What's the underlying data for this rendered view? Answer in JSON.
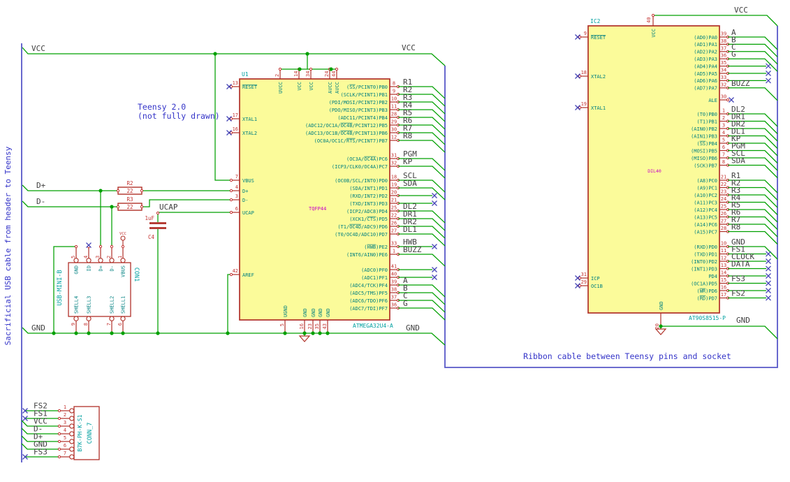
{
  "colors": {
    "wire": "#00A000",
    "bus": "#5858C8",
    "component_outline": "#B03028",
    "ic_fill": "#FBFB9A",
    "pin_number": "#C33432",
    "pin_name": "#008080",
    "ref_value": "#00A0A0",
    "footprint": "#C800C8",
    "net_label": "#3F3F3F",
    "note": "#3434C8",
    "no_connect": "#4848B8",
    "junction": "#00A000"
  },
  "notes": {
    "left_cable": "Sacrificial USB cable from header to Teensy",
    "teensy_1": "Teensy 2.0",
    "teensy_2": "(not fully drawn)",
    "ribbon": "Ribbon cable between Teensy pins and socket"
  },
  "power": {
    "vcc": "VCC",
    "gnd": "GND",
    "dplus": "D+",
    "dminus": "D-",
    "ucap": "UCAP"
  },
  "r2": {
    "ref": "R2",
    "value": "22"
  },
  "r3": {
    "ref": "R3",
    "value": "22"
  },
  "c4": {
    "ref": "C4",
    "value": "1uF"
  },
  "u1": {
    "ref": "U1",
    "value": "ATMEGA32U4-A",
    "footprint": "TQFP44",
    "left_pins": [
      {
        "num": "13",
        "name": "~RESET~",
        "nc": true
      },
      {
        "num": "17",
        "name": "XTAL1",
        "nc": true
      },
      {
        "num": "16",
        "name": "XTAL2",
        "nc": true
      },
      {
        "num": "7",
        "name": "VBUS"
      },
      {
        "num": "4",
        "name": "D+"
      },
      {
        "num": "3",
        "name": "D-"
      },
      {
        "num": "6",
        "name": "UCAP"
      },
      {
        "num": "42",
        "name": "AREF"
      }
    ],
    "top_pins": [
      {
        "num": "2",
        "name": "UVCC"
      },
      {
        "num": "14",
        "name": "VCC"
      },
      {
        "num": "34",
        "name": "VCC"
      },
      {
        "num": "24",
        "name": "AVCC"
      },
      {
        "num": "44",
        "name": "AVCC"
      }
    ],
    "bottom_pins": [
      {
        "num": "5",
        "name": "UGND"
      },
      {
        "num": "16",
        "name": "GND"
      },
      {
        "num": "23",
        "name": "GND"
      },
      {
        "num": "35",
        "name": "GND"
      },
      {
        "num": "43",
        "name": "GND"
      }
    ],
    "right_groups": [
      {
        "pins": [
          {
            "num": "8",
            "name": "(~SS~/PCINT0)PB0",
            "net": "R1"
          },
          {
            "num": "9",
            "name": "(SCLK/PCINT1)PB1",
            "net": "R2"
          },
          {
            "num": "10",
            "name": "(PDI/MOSI/PCINT2)PB2",
            "net": "R3"
          },
          {
            "num": "11",
            "name": "(PDO/MISO/PCINT3)PB3",
            "net": "R4"
          },
          {
            "num": "28",
            "name": "(ADC11/PCINT4)PB4",
            "net": "R5"
          },
          {
            "num": "29",
            "name": "(ADC12/OC1A/~OC4B~/PCINT12)PB5",
            "net": "R6"
          },
          {
            "num": "30",
            "name": "(ADC13/OC1B/~OC4B~/PCINT13)PB6",
            "net": "R7"
          },
          {
            "num": "12",
            "name": "(OC0A/OC1C/~RTS~/PCINT7)PB7",
            "net": "R8"
          }
        ]
      },
      {
        "pins": [
          {
            "num": "31",
            "name": "(OC3A/~OC4A~)PC6",
            "net": "PGM"
          },
          {
            "num": "32",
            "name": "(ICP3/CLK0/OC4A)PC7",
            "net": "KP"
          }
        ]
      },
      {
        "pins": [
          {
            "num": "18",
            "name": "(OC0B/SCL/INT0)PD0",
            "net": "SCL"
          },
          {
            "num": "19",
            "name": "(SDA/INT1)PD1",
            "net": "SDA"
          },
          {
            "num": "20",
            "name": "(RXD/INT2)PD2",
            "nc": true
          },
          {
            "num": "21",
            "name": "(TXD/INT3)PD3",
            "nc": true
          },
          {
            "num": "25",
            "name": "(ICP2/ADC8)PD4",
            "net": "DL2"
          },
          {
            "num": "22",
            "name": "(XCK1/~CTS~)PD5",
            "net": "DR1"
          },
          {
            "num": "26",
            "name": "(T1/~OC4D~/ADC9)PD6",
            "net": "DR2"
          },
          {
            "num": "27",
            "name": "(T0/OC4D/ADC10)PD7",
            "net": "DL1"
          }
        ]
      },
      {
        "pins": [
          {
            "num": "33",
            "name": "(~HWB~)PE2",
            "net": "HWB",
            "nc": true
          },
          {
            "num": "1",
            "name": "(INT6/AIN0)PE6",
            "net": "BUZZ"
          }
        ]
      },
      {
        "pins": [
          {
            "num": "41",
            "name": "(ADC0)PF0",
            "nc": true
          },
          {
            "num": "40",
            "name": "(ADC1)PF1",
            "nc": true
          },
          {
            "num": "39",
            "name": "(ADC4/TCK)PF4",
            "net": "A"
          },
          {
            "num": "38",
            "name": "(ADC5/TMS)PF5",
            "net": "B"
          },
          {
            "num": "37",
            "name": "(ADC6/TDO)PF6",
            "net": "C"
          },
          {
            "num": "36",
            "name": "(ADC7/TDI)PF7",
            "net": "G"
          }
        ]
      }
    ]
  },
  "ic2": {
    "ref": "IC2",
    "value": "AT90S8515-P",
    "footprint": "DIL40",
    "left_pins": [
      {
        "num": "9",
        "name": "~RESET~",
        "nc": true
      },
      {
        "num": "18",
        "name": "XTAL2",
        "nc": true
      },
      {
        "num": "19",
        "name": "XTAL1",
        "nc": true
      },
      {
        "num": "31",
        "name": "ICP",
        "nc": true
      },
      {
        "num": "29",
        "name": "OC1B",
        "nc": true
      }
    ],
    "top_pins": [
      {
        "num": "40",
        "name": "VCC"
      }
    ],
    "bottom_pins": [
      {
        "num": "20",
        "name": "GND"
      }
    ],
    "right_groups": [
      {
        "pins": [
          {
            "num": "39",
            "name": "(AD0)PA0",
            "net": "A"
          },
          {
            "num": "38",
            "name": "(AD1)PA1",
            "net": "B"
          },
          {
            "num": "37",
            "name": "(AD2)PA2",
            "net": "C"
          },
          {
            "num": "36",
            "name": "(AD3)PA3",
            "net": "G"
          },
          {
            "num": "35",
            "name": "(AD4)PA4",
            "nc": true
          },
          {
            "num": "34",
            "name": "(AD5)PA5",
            "nc": true
          },
          {
            "num": "33",
            "name": "(AD6)PA6",
            "nc": true
          },
          {
            "num": "32",
            "name": "(AD7)PA7",
            "net": "BUZZ"
          }
        ]
      },
      {
        "pins": [
          {
            "num": "30",
            "name": "ALE",
            "nc": true,
            "short": true
          }
        ]
      },
      {
        "pins": [
          {
            "num": "1",
            "name": "(T0)PB0",
            "net": "DL2"
          },
          {
            "num": "2",
            "name": "(T1)PB1",
            "net": "DR1"
          },
          {
            "num": "3",
            "name": "(AIN0)PB2",
            "net": "DR2"
          },
          {
            "num": "4",
            "name": "(AIN1)PB3",
            "net": "DL1"
          },
          {
            "num": "5",
            "name": "(~SS~)PB4",
            "net": "KP"
          },
          {
            "num": "6",
            "name": "(MOSI)PB5",
            "net": "PGM"
          },
          {
            "num": "7",
            "name": "(MISO)PB6",
            "net": "SCL"
          },
          {
            "num": "8",
            "name": "(SCK)PB7",
            "net": "SDA"
          }
        ]
      },
      {
        "pins": [
          {
            "num": "21",
            "name": "(A8)PC0",
            "net": "R1"
          },
          {
            "num": "22",
            "name": "(A9)PC1",
            "net": "R2"
          },
          {
            "num": "23",
            "name": "(A10)PC2",
            "net": "R3"
          },
          {
            "num": "24",
            "name": "(A11)PC3",
            "net": "R4"
          },
          {
            "num": "25",
            "name": "(A12)PC4",
            "net": "R5"
          },
          {
            "num": "26",
            "name": "(A13)PC5",
            "net": "R6"
          },
          {
            "num": "27",
            "name": "(A14)PC6",
            "net": "R7"
          },
          {
            "num": "28",
            "name": "(A15)PC7",
            "net": "R8"
          }
        ]
      },
      {
        "pins": [
          {
            "num": "10",
            "name": "(RXD)PD0",
            "net": "GND"
          },
          {
            "num": "11",
            "name": "(TXD)PD1",
            "net": "FS1",
            "nc": true
          },
          {
            "num": "12",
            "name": "(INT0)PD2",
            "net": "CLOCK",
            "nc": true
          },
          {
            "num": "13",
            "name": "(INT1)PD3",
            "net": "DATA",
            "nc": true
          },
          {
            "num": "14",
            "name": "PD4",
            "nc": true
          },
          {
            "num": "15",
            "name": "(OC1A)PD5",
            "net": "FS3",
            "nc": true
          },
          {
            "num": "16",
            "name": "(~WR~)PD6",
            "nc": true
          },
          {
            "num": "17",
            "name": "(~RD~)PD7",
            "net": "FS2",
            "nc": true
          }
        ]
      }
    ]
  },
  "con1": {
    "ref": "CON1",
    "part": "USB-MINI-B",
    "vcc_symbol": "VCC",
    "top_pins": [
      {
        "num": "5",
        "name": "GND"
      },
      {
        "num": "4",
        "name": "ID",
        "nc": true
      },
      {
        "num": "3",
        "name": "D+"
      },
      {
        "num": "2",
        "name": "D-"
      },
      {
        "num": "1",
        "name": "VBUS"
      }
    ],
    "bottom_pins": [
      {
        "num": "9",
        "name": "SHELL4"
      },
      {
        "num": "8",
        "name": "SHELL3"
      },
      {
        "num": "7",
        "name": "SHELL2"
      },
      {
        "num": "6",
        "name": "SHELL1"
      }
    ]
  },
  "conn7": {
    "ref": "CONN_7",
    "part": "B7K-PH-K-S1",
    "pins": [
      {
        "num": "1",
        "net": "FS2",
        "nc": true
      },
      {
        "num": "2",
        "net": "FS1",
        "nc": true
      },
      {
        "num": "3",
        "net": "VCC"
      },
      {
        "num": "4",
        "net": "D-"
      },
      {
        "num": "5",
        "net": "D+"
      },
      {
        "num": "6",
        "net": "GND"
      },
      {
        "num": "7",
        "net": "FS3",
        "nc": true
      }
    ]
  }
}
